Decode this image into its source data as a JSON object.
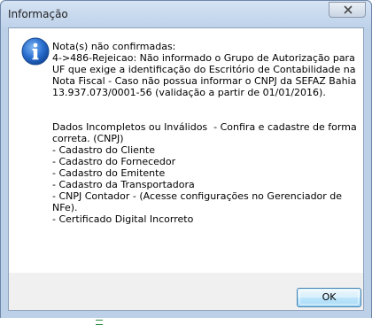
{
  "window": {
    "title": "Informação"
  },
  "dialog": {
    "icon": "info-icon",
    "message": "Nota(s) não confirmadas:\n4->486-Rejeicao: Não informado o Grupo de Autorização para UF que exige a identificação do Escritório de Contabilidade na Nota Fiscal - Caso não possua informar o CNPJ da SEFAZ Bahia 13.937.073/0001-56 (validação a partir de 01/01/2016).\n\n\nDados Incompletos ou Inválidos  - Confira e cadastre de forma correta. (CNPJ)\n- Cadastro do Cliente\n- Cadastro do Fornecedor\n- Cadastro do Emitente\n- Cadastro da Transportadora\n- CNPJ Contador - (Acesse configurações no Gerenciador de NFe).\n- Certificado Digital Incorreto",
    "ok_label": "OK"
  },
  "colors": {
    "frame": "#bcd0e8",
    "icon_blue": "#1f5fbf",
    "button_border": "#3c7fb1"
  }
}
